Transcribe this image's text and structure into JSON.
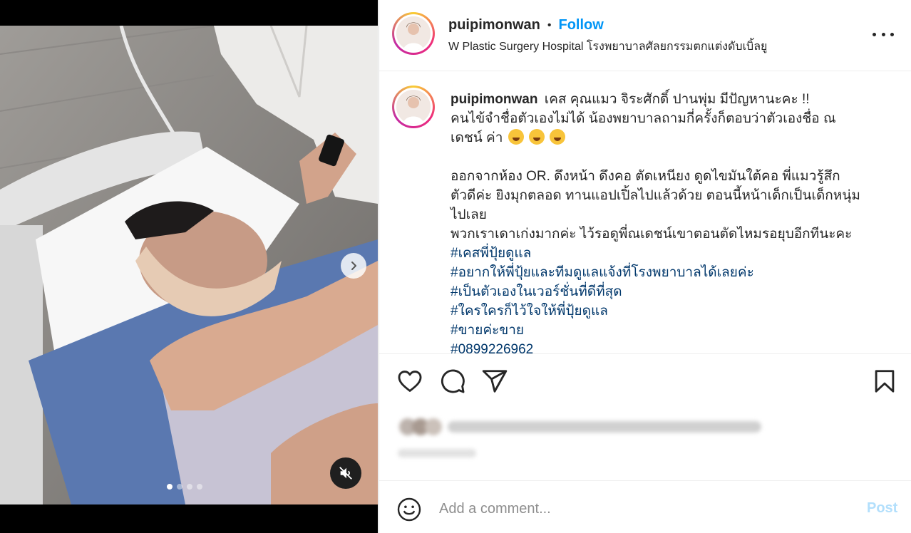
{
  "post": {
    "username": "puipimonwan",
    "separator": "•",
    "follow_label": "Follow",
    "location": "W Plastic Surgery Hospital โรงพยาบาลศัลยกรรมตกแต่งดับเบิ้ลยู"
  },
  "caption": {
    "username": "puipimonwan",
    "line1": "เคส คุณแมว จิระศักดิ์ ปานพุ่ม มีปัญหานะคะ !!",
    "line2": "คนไข้จำชื่อตัวเองไม่ได้ น้องพยาบาลถามกี่ครั้งก็ตอบว่าตัวเองชื่อ ณ",
    "line3": "เดชน์ ค่า",
    "line4": "ออกจากห้อง OR. ดึงหน้า ดึงคอ ตัดเหนียง ดูดไขมันใต้คอ พี่แมวรู้สึก",
    "line5": "ตัวดีค่ะ ยิงมุกตลอด ทานแอปเปิ้ลไปแล้วด้วย ตอนนี้หน้าเด็กเป็นเด็กหนุ่ม",
    "line6": "ไปเลย",
    "line7": "พวกเราเดาเก่งมากค่ะ ไว้รอดูพี่ณเดชน์เขาตอนตัดไหมรอยุบอีกทีนะคะ",
    "hashtags": [
      "#เคสพี่ปุ้ยดูแล",
      "#อยากให้พี่ปุ้ยและทีมดูแลแจ้งที่โรงพยาบาลได้เลยค่ะ",
      "#เป็นตัวเองในเวอร์ชั่นที่ดีที่สุด",
      "#ใครใครก็ไว้ใจให้พี่ปุ้ยดูแล",
      "#ขายค่ะขาย",
      "#0899226962"
    ]
  },
  "comment_box": {
    "placeholder": "Add a comment...",
    "post_label": "Post"
  },
  "carousel": {
    "slides": 4,
    "active_slide": 1
  },
  "icons": {
    "more": "more-options-icon",
    "next": "chevron-right-icon",
    "mute": "muted-speaker-icon",
    "like": "heart-icon",
    "comment": "comment-bubble-icon",
    "share": "paper-plane-icon",
    "save": "bookmark-icon",
    "emoji": "smiley-icon"
  },
  "colors": {
    "accent": "#0095f6",
    "hashtag": "#00376b",
    "post_disabled": "#b2dffc"
  }
}
